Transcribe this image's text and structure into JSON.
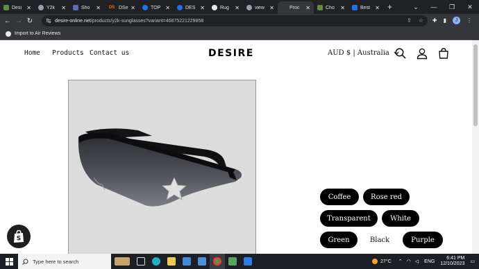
{
  "browser": {
    "tabs": [
      {
        "label": "Desi",
        "favicon": "shopify-icon",
        "color": "#5e8e3e"
      },
      {
        "label": "Y2k",
        "favicon": "circle-icon",
        "color": "#9aa0a6"
      },
      {
        "label": "Sho",
        "favicon": "shopify-icon",
        "color": "#5c6ac4"
      },
      {
        "label": "DSe",
        "favicon": "ds-icon",
        "color": "#e8710a"
      },
      {
        "label": "TOP",
        "favicon": "globe-icon",
        "color": "#1a73e8"
      },
      {
        "label": "DES",
        "favicon": "globe-icon",
        "color": "#1a73e8"
      },
      {
        "label": "Rug",
        "favicon": "r-icon",
        "color": "#e8eaed"
      },
      {
        "label": "view",
        "favicon": "link-icon",
        "color": "#9aa0a6"
      },
      {
        "label": "Proc",
        "favicon": "blank-icon",
        "color": "#202124"
      },
      {
        "label": "Cho",
        "favicon": "shopify-icon",
        "color": "#5e8e3e"
      },
      {
        "label": "Best",
        "favicon": "arrow-icon",
        "color": "#1a73e8"
      }
    ],
    "new_tab": "+",
    "url_host": "desire-online.net",
    "url_path": "/products/y2k-sunglasses?variant=46875221229858",
    "profile_initial": "J",
    "bookmark": "Import to Air Reviews"
  },
  "site": {
    "nav": [
      "Home",
      "Products",
      "Contact us"
    ],
    "logo": "DESIRE",
    "currency": "AUD $ | Australia",
    "variants": {
      "colors": [
        {
          "label": "Coffee",
          "selected": false
        },
        {
          "label": "Rose red",
          "selected": false
        },
        {
          "label": "Transparent",
          "selected": false
        },
        {
          "label": "White",
          "selected": false
        },
        {
          "label": "Green",
          "selected": false
        },
        {
          "label": "Black",
          "selected": true
        },
        {
          "label": "Purple",
          "selected": false
        }
      ]
    }
  },
  "taskbar": {
    "search_placeholder": "Type here to search",
    "temperature": "27°C",
    "language": "ENG",
    "time": "6:41 PM",
    "date": "12/10/2023"
  },
  "colors": {
    "browser_dark": "#202124",
    "toolbar": "#35363a",
    "chip_bg": "#000000",
    "taskbar": "#1c1f26"
  }
}
